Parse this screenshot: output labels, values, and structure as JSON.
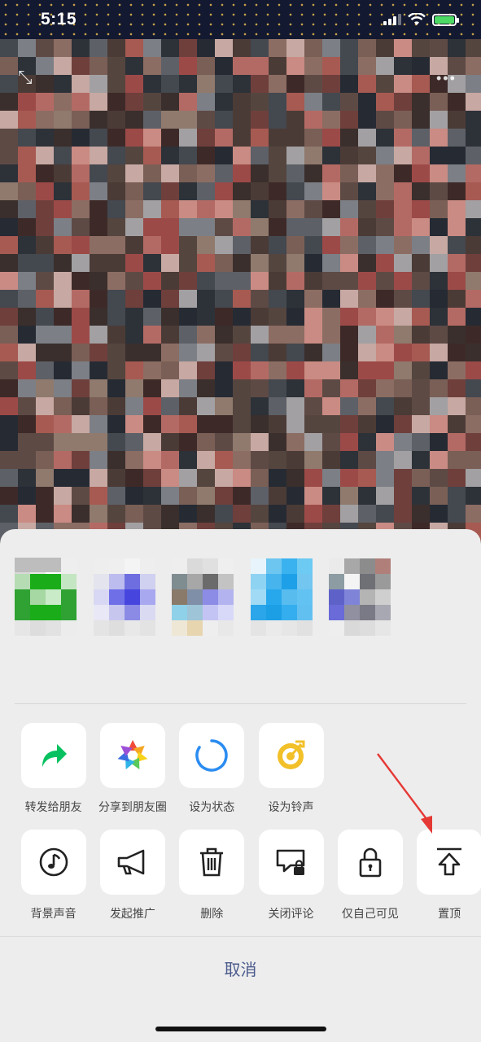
{
  "status_bar": {
    "time": "5:15"
  },
  "top_controls": {
    "menu": "•••"
  },
  "share_sheet": {
    "contacts_header_masked": true,
    "row1": [
      {
        "label": "转发给朋友",
        "icon": "forward-arrow-icon"
      },
      {
        "label": "分享到朋友圈",
        "icon": "moments-aperture-icon"
      },
      {
        "label": "设为状态",
        "icon": "status-ring-icon"
      },
      {
        "label": "设为铃声",
        "icon": "ringtone-icon"
      }
    ],
    "row2": [
      {
        "label": "背景声音",
        "icon": "music-note-icon"
      },
      {
        "label": "发起推广",
        "icon": "megaphone-icon"
      },
      {
        "label": "删除",
        "icon": "trash-icon"
      },
      {
        "label": "关闭评论",
        "icon": "comment-lock-icon"
      },
      {
        "label": "仅自己可见",
        "icon": "padlock-icon"
      },
      {
        "label": "置顶",
        "icon": "pin-top-icon"
      }
    ],
    "cancel": "取消"
  },
  "colors": {
    "accent_green": "#1aad19",
    "forward_green": "#07c160",
    "status_blue": "#2b8cf0",
    "ringtone_yellow": "#f2c029",
    "cancel_text": "#4a5a8c",
    "annotation_red": "#e53935"
  }
}
